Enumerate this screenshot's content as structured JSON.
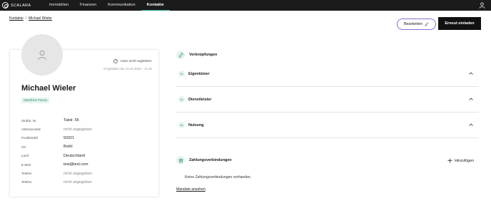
{
  "brand": {
    "name": "SCALARA"
  },
  "nav": {
    "items": [
      {
        "label": "Immobilien"
      },
      {
        "label": "Finanzen"
      },
      {
        "label": "Kommunikation"
      },
      {
        "label": "Kontakte"
      }
    ],
    "active": "Kontakte"
  },
  "breadcrumb": {
    "root": "Kontakte",
    "separator": "/",
    "current": "Michael Wieler"
  },
  "actions": {
    "edit_label": "Bearbeiten",
    "invite_label": "Erneut einladen"
  },
  "profile": {
    "registration_status": "User nicht registriert",
    "invited": "Eingeladen am 11.10.2023 – 11:25",
    "name": "Michael Wieler",
    "tag": "Natürliche Person",
    "fields": [
      {
        "label": "Straße, Nr.",
        "value": "Talstr. 55",
        "empty": false
      },
      {
        "label": "Adresszusatz",
        "value": "nicht angegeben",
        "empty": true
      },
      {
        "label": "Postleitzahl",
        "value": "50321",
        "empty": false
      },
      {
        "label": "Ort",
        "value": "Brühl",
        "empty": false
      },
      {
        "label": "Land",
        "value": "Deutschland",
        "empty": false
      },
      {
        "label": "E-Mail",
        "value": "test@test.com",
        "empty": false
      },
      {
        "label": "Telefon",
        "value": "nicht angegeben",
        "empty": true
      },
      {
        "label": "Telefon",
        "value": "nicht angegeben",
        "empty": true
      }
    ]
  },
  "links_section": {
    "title": "Verknüpfungen",
    "groups": [
      {
        "count": "0x",
        "label": "Eigentümer"
      },
      {
        "count": "4x",
        "label": "Dienstleister"
      },
      {
        "count": "0x",
        "label": "Nutzung"
      }
    ]
  },
  "payments": {
    "title": "Zahlungsverbindungen",
    "add_label": "Hinzufügen",
    "empty_message": "Keine Zahlungsverbindungen vorhanden.",
    "mandate_link": "Mandate ansehen"
  },
  "colors": {
    "accent": "#2ea29a",
    "highlight": "#8f6ad6",
    "topbar": "#1b1b1b"
  }
}
